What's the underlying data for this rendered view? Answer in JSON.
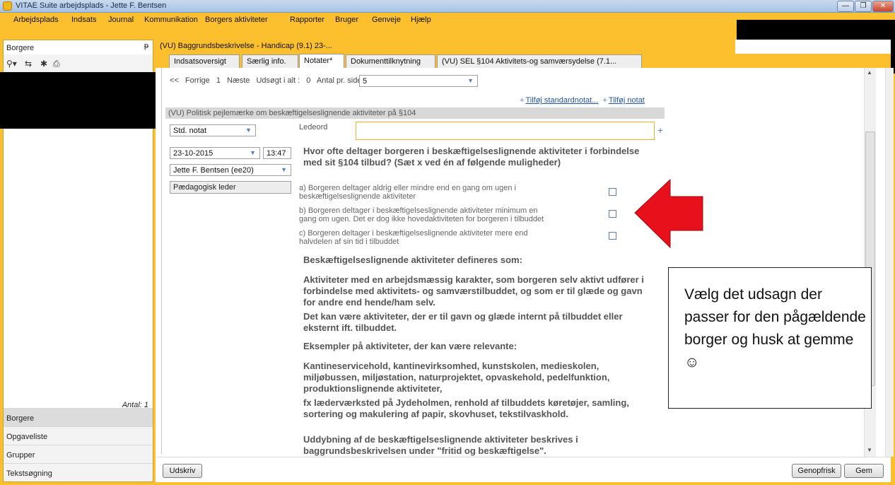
{
  "window": {
    "title": "VITAE Suite arbejdsplads - Jette F. Bentsen",
    "min": "—",
    "restore": "❐",
    "close": "✕"
  },
  "menu": {
    "items": [
      {
        "label": "Arbejdsplads"
      },
      {
        "label": "Indsats"
      },
      {
        "label": "Journal"
      },
      {
        "label": "Kommunikation"
      },
      {
        "label": "Borgers aktiviteter"
      },
      {
        "label": "Rapporter"
      },
      {
        "label": "Bruger"
      },
      {
        "label": "Genveje"
      },
      {
        "label": "Hjælp"
      }
    ]
  },
  "left_panel": {
    "title": "Borgere",
    "pin": "ᵽ",
    "antal": "Antal: 1",
    "nav": [
      "Borgere",
      "Opgaveliste",
      "Grupper",
      "Tekstsøgning"
    ]
  },
  "document": {
    "title": "(VU) Baggrundsbeskrivelse - Handicap (9.1) 23-...",
    "tabs": [
      {
        "label": "Indsatsoversigt"
      },
      {
        "label": "Særlig info."
      },
      {
        "label": "Notater*"
      },
      {
        "label": "Dokumenttilknytning"
      },
      {
        "label": "(VU) SEL §104 Aktivitets-og samværsydelse (7.1..."
      }
    ]
  },
  "pager": {
    "prev": "<<",
    "forrige": "Forrige",
    "page": "1",
    "naeste": "Næste",
    "udsogt_label": "Udsøgt i alt :",
    "udsogt_value": "0",
    "antal_label": "Antal pr. side",
    "antal_value": "5"
  },
  "links": {
    "add_standard": "Tilføj standardnotat...",
    "add_note": "Tilføj notat"
  },
  "note": {
    "section_title": "(VU) Politisk pejlemærke om beskæftigelseslignende aktiviteter på §104",
    "type": "Std. notat",
    "date": "23-10-2015",
    "time": "13:47",
    "author": "Jette F. Bentsen (ee20)",
    "role": "Pædagogisk leder",
    "ledeord_label": "Ledeord",
    "question": "Hvor ofte deltager borgeren i beskæftigelseslignende aktiviteter i forbindelse med sit §104 tilbud? (Sæt x ved én af følgende muligheder)",
    "options": [
      {
        "line1": "a) Borgeren deltager aldrig eller mindre end en gang om ugen i",
        "line2": "beskæftigelseslignende aktiviteter"
      },
      {
        "line1": "b) Borgeren deltager i beskæftigelseslignende aktiviteter minimum en",
        "line2": "gang om ugen. Det er dog ikke hovedaktiviteten for borgeren i tilbuddet"
      },
      {
        "line1": "c) Borgeren deltager i beskæftigelseslignende aktiviteter mere end",
        "line2": "halvdelen af sin tid i tilbuddet"
      }
    ],
    "paragraphs": [
      "Beskæftigelseslignende aktiviteter defineres som:",
      "Aktiviteter med en arbejdsmæssig karakter, som borgeren selv aktivt udfører i forbindelse med aktivitets- og samværstilbuddet, og som er til glæde og gavn for andre end hende/ham selv.",
      "Det kan være aktiviteter, der er til gavn og glæde internt på tilbuddet eller eksternt ift. tilbuddet.",
      "Eksempler på aktiviteter, der kan være relevante:",
      "Kantineservicehold, kantinevirksomhed, kunstskolen, medieskolen, miljøbussen, miljøstation, naturprojektet, opvaskehold, pedelfunktion, produktionslignende aktiviteter,",
      "fx læderværksted på Jydeholmen, renhold af tilbuddets køretøjer, samling, sortering og makulering af papir, skovhuset, tekstilvaskhold.",
      "Uddybning af de beskæftigelseslignende aktiviteter beskrives i baggrundsbeskrivelsen under \"fritid og beskæftigelse\"."
    ]
  },
  "buttons": {
    "print": "Udskriv",
    "refresh": "Genopfrisk",
    "save": "Gem"
  },
  "annotation": {
    "text": "Vælg det udsagn der passer for den pågældende borger og husk at gemme ☺"
  },
  "colors": {
    "frame": "#fcbf2e",
    "arrow": "#e8101a",
    "link": "#2456a4"
  }
}
